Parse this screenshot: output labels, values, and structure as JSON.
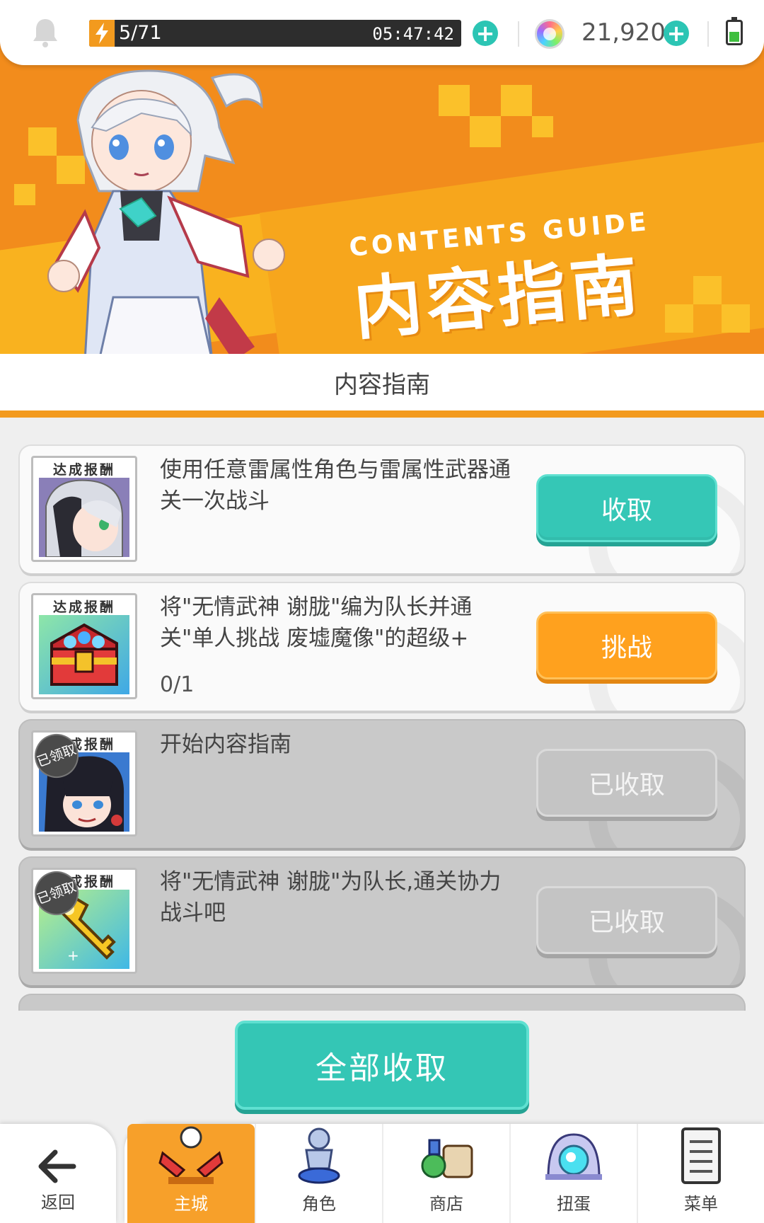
{
  "status_bar": {
    "stamina": "5/71",
    "stamina_fraction": 0.07,
    "timer": "05:47:42",
    "gems": "21,920"
  },
  "banner": {
    "subtitle_en": "CONTENTS GUIDE",
    "title_cn": "内容指南"
  },
  "section": {
    "title": "内容指南"
  },
  "quests": [
    {
      "tag": "达成报酬",
      "text": "使用任意雷属性角色与雷属性武器通关一次战斗",
      "progress": "",
      "button": "收取",
      "state": "claimable"
    },
    {
      "tag": "达成报酬",
      "text": "将\"无情武神 谢胧\"编为队长并通关\"单人挑战 废墟魔像\"的超级+",
      "progress": "0/1",
      "button": "挑战",
      "state": "challenge"
    },
    {
      "tag": "达成报酬",
      "stamp": "已领取",
      "text": "开始内容指南",
      "progress": "",
      "button": "已收取",
      "state": "claimed"
    },
    {
      "tag": "达成报酬",
      "stamp": "已领取",
      "text": "将\"无情武神 谢胧\"为队长,通关协力战斗吧",
      "progress": "",
      "button": "已收取",
      "state": "claimed"
    }
  ],
  "claim_all_label": "全部收取",
  "nav": {
    "back": "返回",
    "items": [
      "主城",
      "角色",
      "商店",
      "扭蛋",
      "菜单"
    ]
  },
  "colors": {
    "accent_teal": "#35c7b6",
    "accent_orange": "#ffa11e",
    "banner_orange": "#f28c1c"
  }
}
